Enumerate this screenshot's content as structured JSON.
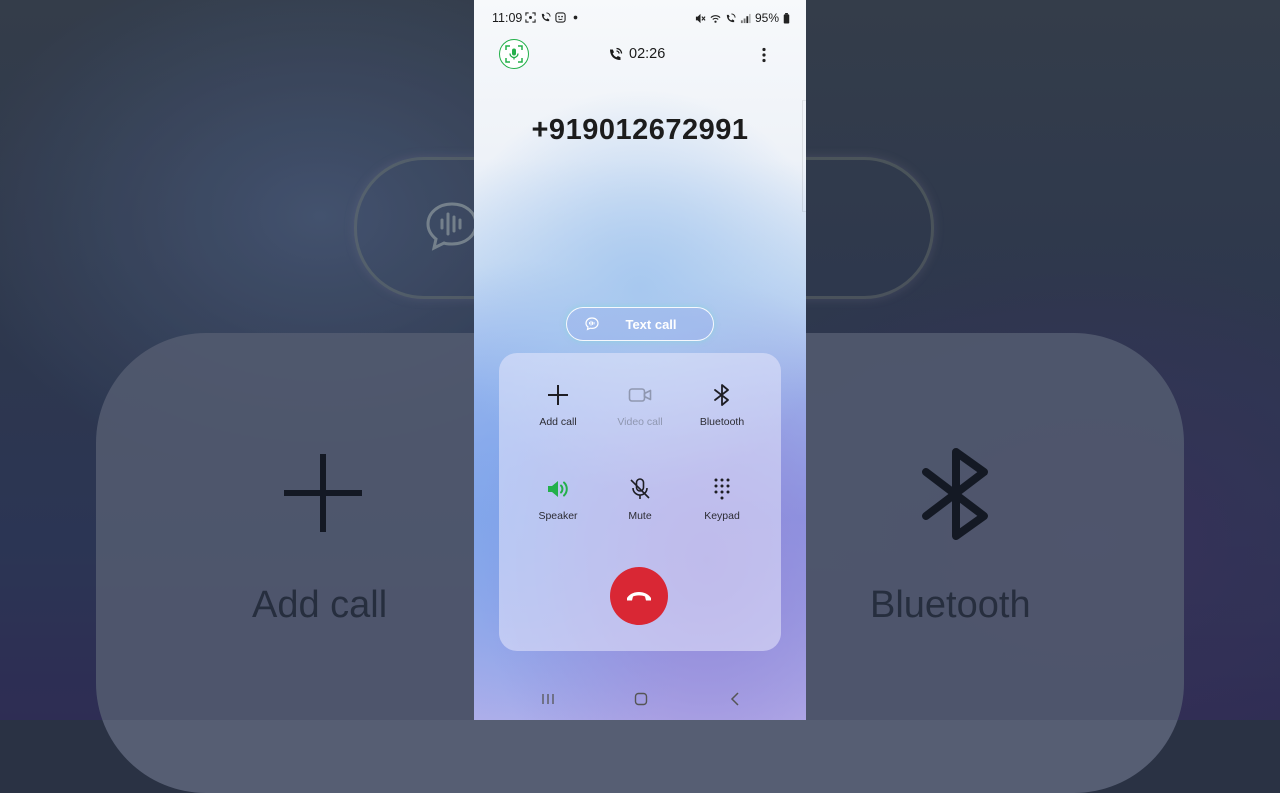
{
  "status_bar": {
    "time": "11:09",
    "battery": "95%",
    "left_icons": [
      "screenshot-icon",
      "wifi-calling-icon",
      "face-icon",
      "dot-icon"
    ],
    "right_icons": [
      "mute-icon",
      "wifi-icon",
      "wifi-calling-icon",
      "signal-icon",
      "battery-icon"
    ]
  },
  "call": {
    "timer": "02:26",
    "number": "+919012672991"
  },
  "text_call": {
    "label": "Text call"
  },
  "controls": [
    {
      "id": "add-call",
      "label": "Add call",
      "icon": "plus-icon",
      "enabled": true
    },
    {
      "id": "video-call",
      "label": "Video call",
      "icon": "video-camera-icon",
      "enabled": false
    },
    {
      "id": "bluetooth",
      "label": "Bluetooth",
      "icon": "bluetooth-icon",
      "enabled": true
    },
    {
      "id": "speaker",
      "label": "Speaker",
      "icon": "speaker-icon",
      "enabled": true,
      "active": true
    },
    {
      "id": "mute",
      "label": "Mute",
      "icon": "mic-off-icon",
      "enabled": true
    },
    {
      "id": "keypad",
      "label": "Keypad",
      "icon": "keypad-icon",
      "enabled": true
    }
  ],
  "background": {
    "add_call": "Add call",
    "bluetooth": "Bluetooth"
  },
  "colors": {
    "end_call": "#d92734",
    "speaker_active": "#23b04a",
    "record_ring": "#23b04a"
  }
}
